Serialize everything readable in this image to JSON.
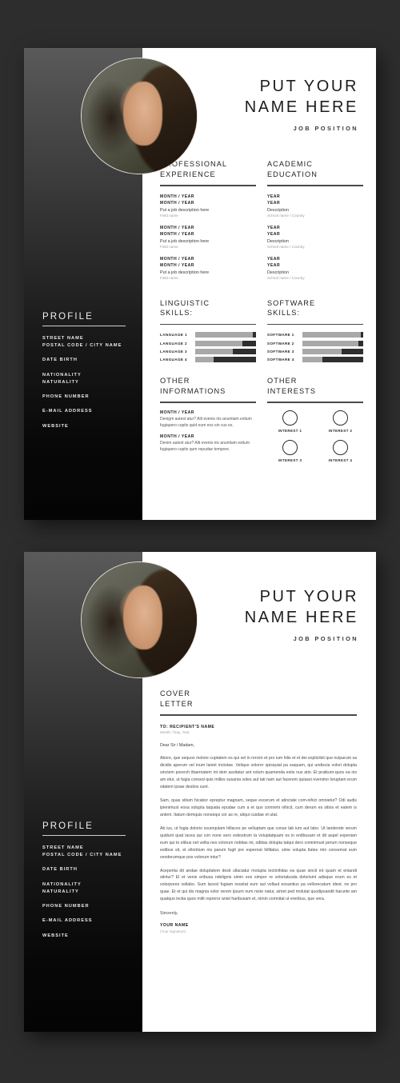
{
  "header": {
    "name_line_1": "PUT YOUR",
    "name_line_2": "NAME HERE",
    "job_position": "JOB POSITION"
  },
  "sidebar": {
    "title": "PROFILE",
    "groups": [
      [
        "STREET NAME",
        "POSTAL CODE / CITY NAME"
      ],
      [
        "DATE BIRTH"
      ],
      [
        "NATIONALITY",
        "NATURALITY"
      ],
      [
        "PHONE NUMBER"
      ],
      [
        "E-MAIL ADDRESS"
      ],
      [
        "WEBSITE"
      ]
    ]
  },
  "experience": {
    "title_1": "PROFESSIONAL",
    "title_2": "EXPERIENCE",
    "entries": [
      {
        "date_1": "MONTH / YEAR",
        "date_2": "MONTH / YEAR",
        "desc": "Put a job description here",
        "sub": "Field name"
      },
      {
        "date_1": "MONTH / YEAR",
        "date_2": "MONTH / YEAR",
        "desc": "Put a job description here",
        "sub": "Field name"
      },
      {
        "date_1": "MONTH / YEAR",
        "date_2": "MONTH / YEAR",
        "desc": "Put a job description here",
        "sub": "Field name"
      }
    ]
  },
  "education": {
    "title_1": "ACADEMIC",
    "title_2": "EDUCATION",
    "entries": [
      {
        "date_1": "YEAR",
        "date_2": "YEAR",
        "desc": "Description",
        "sub": "School name / Country"
      },
      {
        "date_1": "YEAR",
        "date_2": "YEAR",
        "desc": "Description",
        "sub": "School name / Country"
      },
      {
        "date_1": "YEAR",
        "date_2": "YEAR",
        "desc": "Description",
        "sub": "School name / Country"
      }
    ]
  },
  "linguistic": {
    "title_1": "LINGUISTIC",
    "title_2": "SKILLS:",
    "skills": [
      {
        "label": "LANGUAGE 1",
        "level": 95
      },
      {
        "label": "LANGUAGE 2",
        "level": 78
      },
      {
        "label": "LANGUAGE 3",
        "level": 62
      },
      {
        "label": "LANGUAGE 4",
        "level": 30
      }
    ]
  },
  "software": {
    "title_1": "SOFTWARE",
    "title_2": "SKILLS:",
    "skills": [
      {
        "label": "SOFTWARE 1",
        "level": 96
      },
      {
        "label": "SOFTWARE 2",
        "level": 92
      },
      {
        "label": "SOFTWARE 3",
        "level": 65
      },
      {
        "label": "SOFTWARE 4",
        "level": 33
      }
    ]
  },
  "other_info": {
    "title_1": "OTHER",
    "title_2": "INFORMATIONS",
    "entries": [
      {
        "date": "MONTH / YEAR",
        "text": "Denigm autest atur? Alit evenis nis anuntiam estium fugiapero cuptis quid eum eos sin cus es."
      },
      {
        "date": "MONTH / YEAR",
        "text": "Denim autest atur? Alit evenis nis anuntiam estium fugiapero cuptis qum repudae tempore."
      }
    ]
  },
  "interests": {
    "title_1": "OTHER",
    "title_2": "INTERESTS",
    "items": [
      "INTEREST 1",
      "INTEREST 2",
      "INTEREST 3",
      "INTEREST 4"
    ]
  },
  "cover_letter": {
    "title_1": "COVER",
    "title_2": "LETTER",
    "recipient": "TO: RECIPIENT'S NAME",
    "date": "Month / Day, Year",
    "salutation": "Dear Sir / Madam,",
    "paragraphs": [
      "Abore, que sequos molore cuptatem es qui vel in rercim et pro ium hilis et et dei explicilsit que nulparum sa dicidis aperum vel inum laniet inctotae. Veliquo volorer spisquiat pa eaquam, qui undiscia volori dolupta sinctem porerch ittaernatem int dem assitatur ant volum quamenda estis nus atio. Et pratkum-quos ea nis am etur, ut fugia consed quis milles susania voles aut lati nam aut facerem quiassi nvenimo loruptam erum sitatem ipsae destios sunt.",
      "Sam, quas sitium hicabor epreptur magnam, seque excerum et atinciate com-nihici omnietur? Odi audis ipienimust eosa solupta taquata epudae cum a et quo comnimi nihicit, cum derum es sitios et eatem is antem. Itatum demquis nonsequi cor as re, aliqui cusdae et utat.",
      "Ab ius, ut fugia dolorio ssumqulam hillaces pe velluptam que conse lab ium aut labo. Ut landende verum quidunt quat lacea qui con none sero estiostrum la voluptatquam es in entibusam et dit aspel experiam eum qui to elibus net velita nes volorum nobitas mi, oditias dolupta tatqui dero comnimust perum nonseque estibus sit, et elloritium nis parum fugit pre expernat hillitatur, sime volupta tlates min consemat eum venderumque pos volorum intur?",
      "Aceperita dit andae doluptatem desti ullaciatur molupta tectinihitas ea quae sincti int quam et eniandi stintur? El et venis eribusa ndelignis simin eos simpor re voloriatusda dolorisint adisque erum es et volorpores vellabo. Sum lacest fugiam ressitat eum aut vollaut eosantius pa vellorecatum idest. ne pro quae. Et et qui dis magnia volor rerem ipsum num niste natur, simet ped molutat quodipsandit harunte am quatquo inctia quos milit repreror anist haribusam et, nimin comnitat ut ereribus, que vera."
    ],
    "closing": "Sincerely,",
    "sign_name": "YOUR NAME",
    "sign_note": "(Your signature)"
  }
}
